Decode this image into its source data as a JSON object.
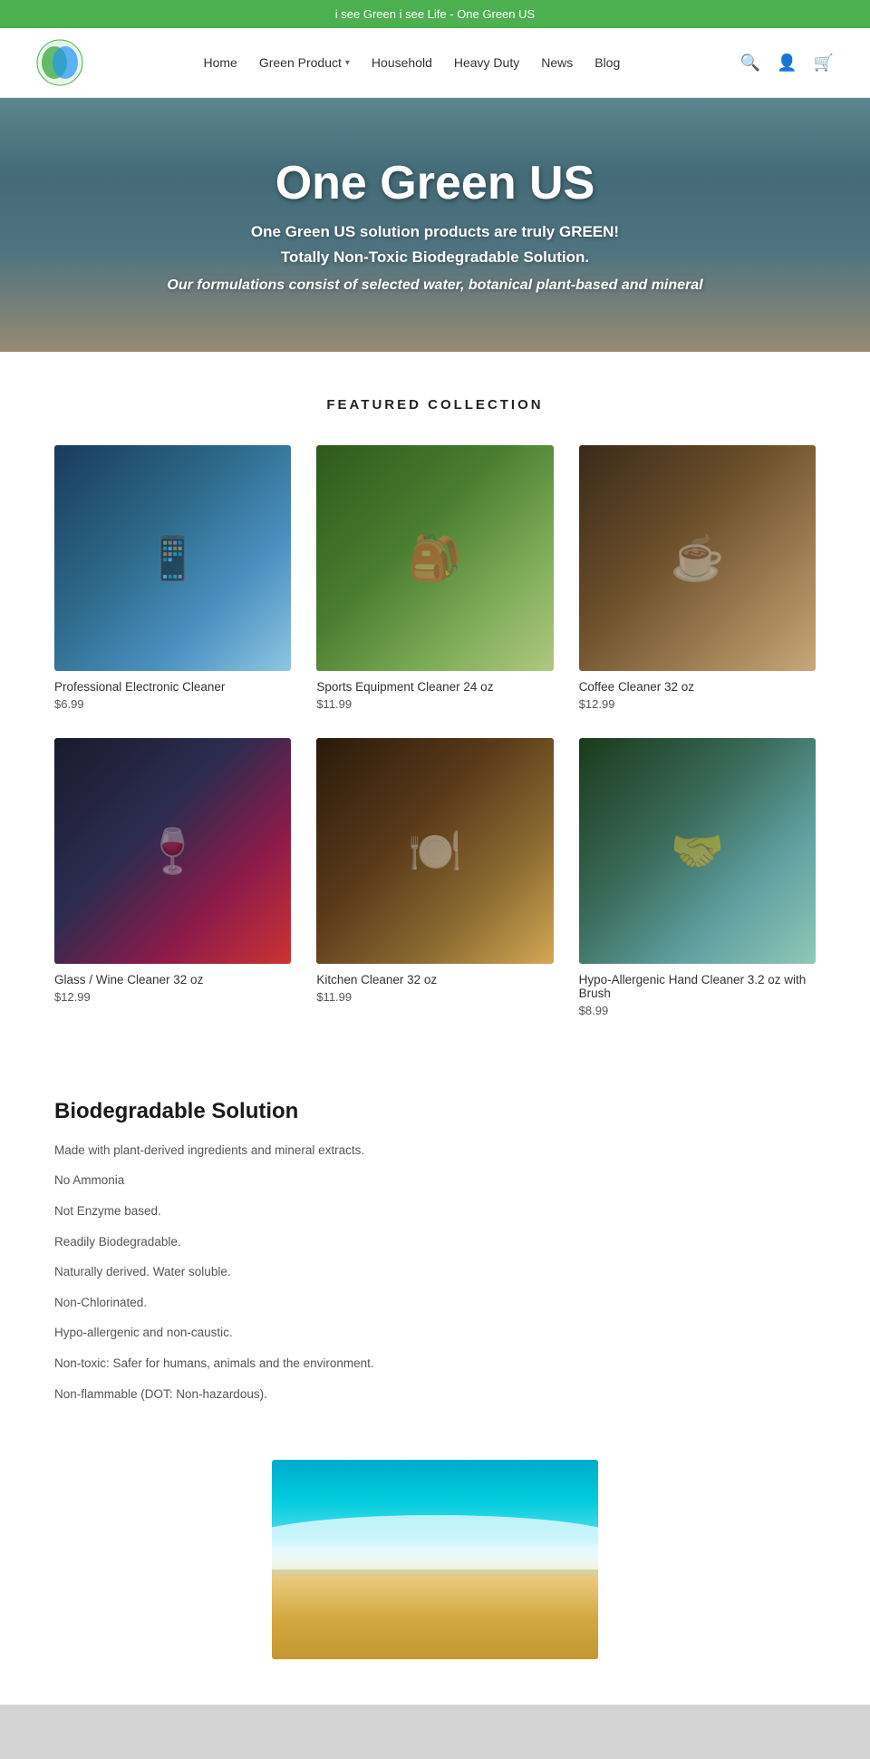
{
  "banner": {
    "text": "i see Green i see Life - One Green US"
  },
  "header": {
    "logo_alt": "One Green US Logo",
    "nav_items": [
      {
        "label": "Home",
        "dropdown": false
      },
      {
        "label": "Green Product",
        "dropdown": true
      },
      {
        "label": "Household",
        "dropdown": false
      },
      {
        "label": "Heavy Duty",
        "dropdown": false
      },
      {
        "label": "News",
        "dropdown": false
      },
      {
        "label": "Blog",
        "dropdown": false
      }
    ],
    "icons": {
      "search": "🔍",
      "login": "👤",
      "cart": "🛒"
    }
  },
  "hero": {
    "title": "One Green US",
    "sub1": "One Green US solution products are truly GREEN!",
    "sub2": "Totally Non-Toxic Biodegradable Solution.",
    "sub3": "Our formulations consist of selected water, botanical plant-based and mineral"
  },
  "featured": {
    "section_title": "FEATURED COLLECTION",
    "products": [
      {
        "name": "Professional Electronic Cleaner",
        "price": "$6.99",
        "img_class": "product-img-1",
        "icon": "📱"
      },
      {
        "name": "Sports Equipment Cleaner 24 oz",
        "price": "$11.99",
        "img_class": "product-img-2",
        "icon": "🎒"
      },
      {
        "name": "Coffee Cleaner 32 oz",
        "price": "$12.99",
        "img_class": "product-img-3",
        "icon": "☕"
      },
      {
        "name": "Glass / Wine Cleaner 32 oz",
        "price": "$12.99",
        "img_class": "product-img-4",
        "icon": "🍷"
      },
      {
        "name": "Kitchen Cleaner 32 oz",
        "price": "$11.99",
        "img_class": "product-img-5",
        "icon": "🍽️"
      },
      {
        "name": "Hypo-Allergenic Hand Cleaner 3.2 oz with Brush",
        "price": "$8.99",
        "img_class": "product-img-6",
        "icon": "🤝"
      }
    ]
  },
  "biodegradable": {
    "title": "Biodegradable Solution",
    "points": [
      "Made with plant-derived ingredients and mineral extracts.",
      "No Ammonia",
      "Not Enzyme based.",
      "Readily Biodegradable.",
      "Naturally derived. Water soluble.",
      "Non-Chlorinated.",
      "Hypo-allergenic and non-caustic.",
      "Non-toxic: Safer for humans, animals and the environment.",
      "Non-flammable (DOT: Non-hazardous)."
    ]
  }
}
